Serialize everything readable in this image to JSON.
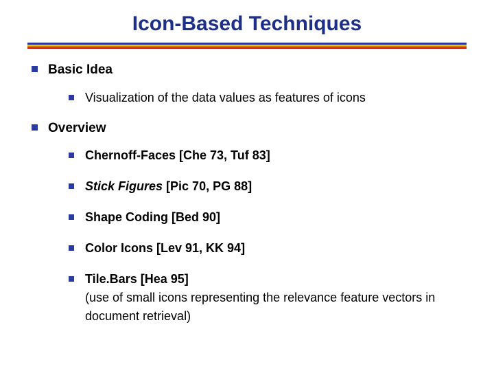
{
  "title": "Icon-Based Techniques",
  "bullets": [
    {
      "label": "Basic Idea",
      "children": [
        {
          "text": "Visualization of the data values as features of icons",
          "bold": false,
          "italic": false,
          "note": ""
        }
      ]
    },
    {
      "label": "Overview",
      "children": [
        {
          "text": "Chernoff-Faces [Che 73, Tuf 83]",
          "bold": true,
          "italic": false,
          "note": ""
        },
        {
          "italic_lead": "Stick Figures",
          "text_rest": " [Pic 70, PG 88]",
          "bold": true
        },
        {
          "text": "Shape Coding [Bed 90]",
          "bold": true,
          "italic": false,
          "note": ""
        },
        {
          "text": "Color Icons [Lev 91, KK 94]",
          "bold": true,
          "italic": false,
          "note": ""
        },
        {
          "text": "Tile.Bars [Hea 95]",
          "bold": true,
          "italic": false,
          "note": "(use of small icons representing the relevance feature vectors in document retrieval)"
        }
      ]
    }
  ]
}
